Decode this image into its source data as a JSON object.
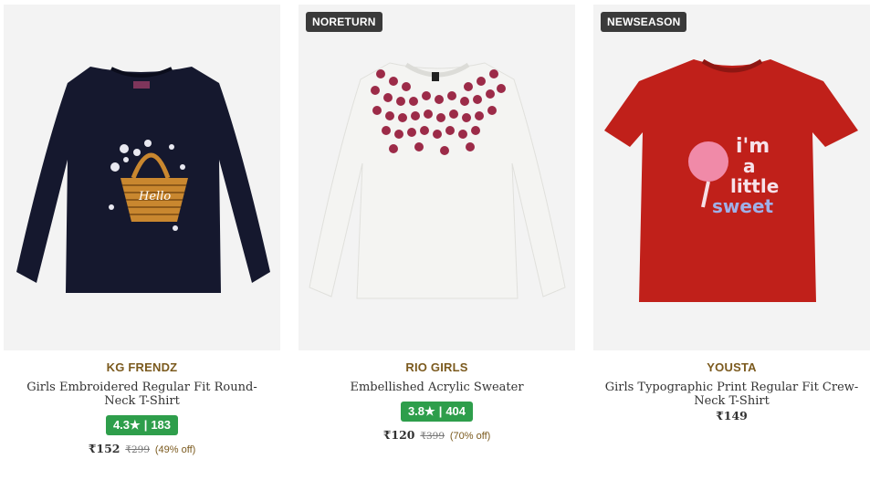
{
  "products": [
    {
      "tag": "",
      "brand": "KG FRENDZ",
      "title": "Girls Embroidered Regular Fit Round-Neck T-Shirt",
      "rating": "4.3",
      "rating_star": "★",
      "rating_sep": "|",
      "rating_count": "183",
      "price": "₹152",
      "mrp": "₹299",
      "discount": "(49% off)",
      "image_icon": "navy-tshirt-basket-icon",
      "shirt_color": "#15182e"
    },
    {
      "tag": "NORETURN",
      "brand": "RIO GIRLS",
      "title": "Embellished Acrylic Sweater",
      "rating": "3.8",
      "rating_star": "★",
      "rating_sep": "|",
      "rating_count": "404",
      "price": "₹120",
      "mrp": "₹399",
      "discount": "(70% off)",
      "image_icon": "white-sweater-sequins-icon",
      "shirt_color": "#f4f4f2"
    },
    {
      "tag": "NEWSEASON",
      "brand": "YOUSTA",
      "title": "Girls Typographic Print Regular Fit Crew-Neck T-Shirt",
      "rating": "",
      "rating_count": "",
      "price": "₹149",
      "mrp": "",
      "discount": "",
      "image_icon": "red-tshirt-print-icon",
      "shirt_color": "#c0201a",
      "print_text": [
        "i'm",
        "a",
        "little",
        "sweet"
      ],
      "hello_text": "Hello"
    }
  ],
  "colors": {
    "brand_text": "#7b5a1e",
    "rating_bg": "#2e9e4b",
    "tag_bg": "#3a3a3a",
    "image_bg": "#f3f3f3"
  }
}
